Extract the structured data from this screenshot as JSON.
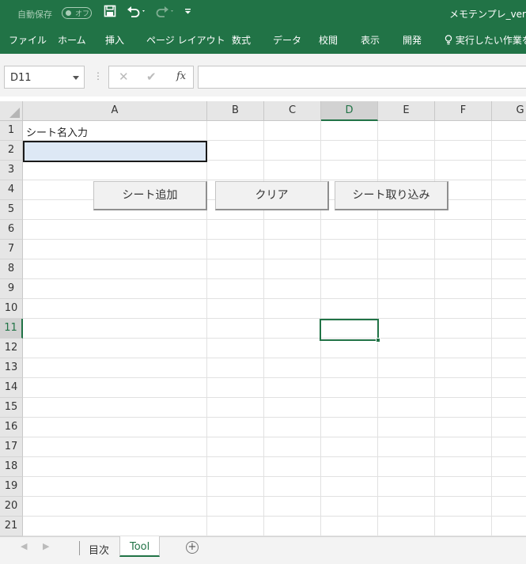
{
  "titlebar": {
    "autosave_label": "自動保存",
    "autosave_state": "オフ",
    "doc_title": "メモテンプレ_ver",
    "icons": [
      "save-icon",
      "undo-icon",
      "redo-icon",
      "customize-icon"
    ]
  },
  "ribbon": {
    "tabs": [
      "ファイル",
      "ホーム",
      "挿入",
      "ページ レイアウト",
      "数式",
      "データ",
      "校閲",
      "表示",
      "開発"
    ],
    "tell_me": "実行したい作業を"
  },
  "formula_bar": {
    "name_box": "D11",
    "cancel_symbol": "✕",
    "enter_symbol": "✔",
    "fx_label": "fx",
    "formula": ""
  },
  "grid": {
    "columns": [
      "A",
      "B",
      "C",
      "D",
      "E",
      "F",
      "G"
    ],
    "rows": [
      "1",
      "2",
      "3",
      "4",
      "5",
      "6",
      "7",
      "8",
      "9",
      "10",
      "11",
      "12",
      "13",
      "14",
      "15",
      "16",
      "17",
      "18",
      "19",
      "20",
      "21"
    ],
    "active_column": "D",
    "active_row": "11",
    "cell_a1": "シート名入力",
    "cell_a2": ""
  },
  "buttons": {
    "add_sheet": "シート追加",
    "clear": "クリア",
    "import_sheet": "シート取り込み"
  },
  "sheets": {
    "tabs": [
      "目次",
      "Tool"
    ],
    "active": "Tool"
  },
  "colors": {
    "excel_green": "#217346",
    "input_fill": "#dde8f5"
  }
}
